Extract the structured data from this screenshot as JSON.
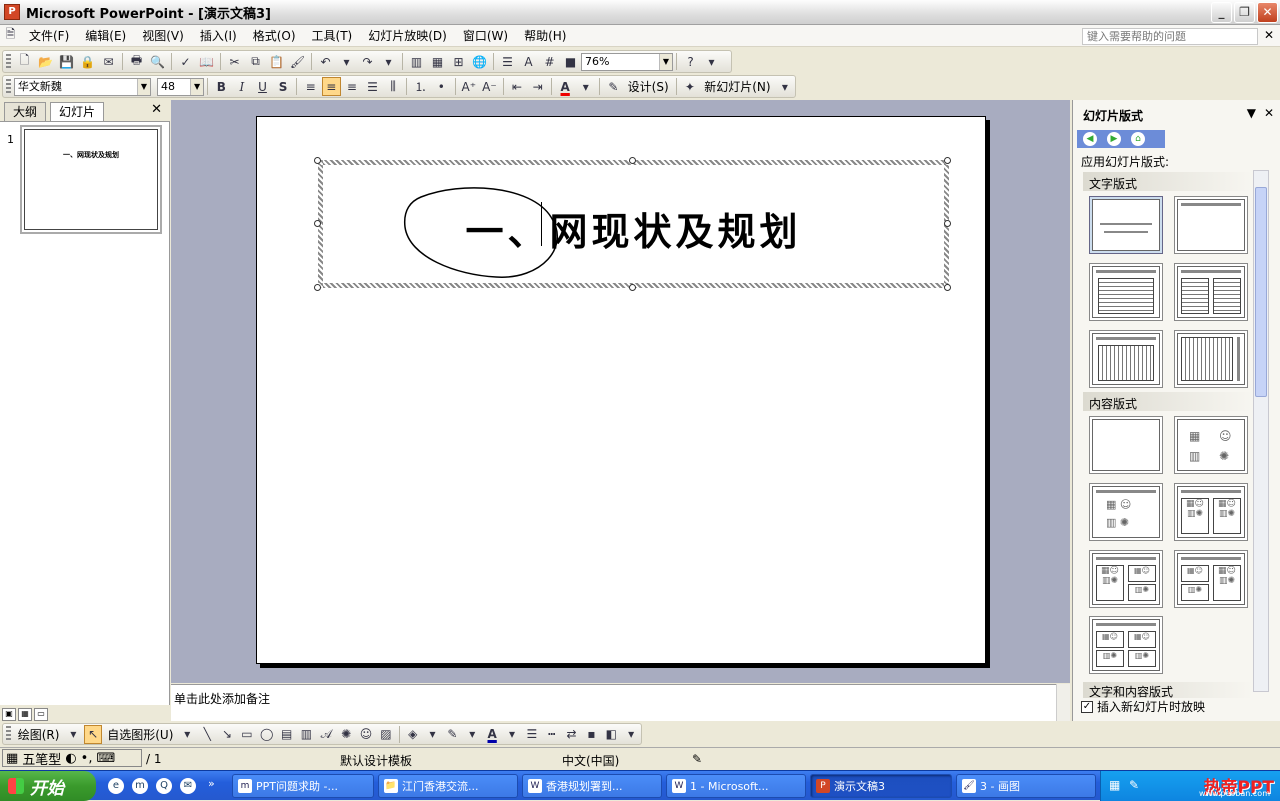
{
  "window": {
    "title": "Microsoft PowerPoint - [演示文稿3]",
    "app_icon": "powerpoint-icon"
  },
  "menu": {
    "items": [
      "文件(F)",
      "编辑(E)",
      "视图(V)",
      "插入(I)",
      "格式(O)",
      "工具(T)",
      "幻灯片放映(D)",
      "窗口(W)",
      "帮助(H)"
    ],
    "help_placeholder": "键入需要帮助的问题"
  },
  "toolbar_standard": {
    "zoom": "76%"
  },
  "toolbar_format": {
    "font": "华文新魏",
    "size": "48",
    "bold": "B",
    "italic": "I",
    "underline": "U",
    "shadow": "S",
    "design_label": "设计(S)",
    "new_slide_label": "新幻灯片(N)"
  },
  "left_panel": {
    "tabs": [
      "大纲",
      "幻灯片"
    ],
    "slide_number": "1",
    "thumb_title": "一、网现状及规划"
  },
  "slide": {
    "title": "一、网现状及规划"
  },
  "notes": {
    "placeholder": "单击此处添加备注"
  },
  "task_pane": {
    "title": "幻灯片版式",
    "apply_label": "应用幻灯片版式:",
    "sections": [
      "文字版式",
      "内容版式",
      "文字和内容版式"
    ],
    "checkbox_label": "插入新幻灯片时放映"
  },
  "drawing_toolbar": {
    "draw_label": "绘图(R)",
    "autoshape_label": "自选图形(U)"
  },
  "status_bar": {
    "slide_count": "/ 1",
    "template": "默认设计模板",
    "language": "中文(中国)",
    "ime_label": "五笔型"
  },
  "taskbar": {
    "start_label": "开始",
    "tasks": [
      "PPT问题求助 -...",
      "江门香港交流...",
      "香港规划署到...",
      "1 - Microsoft...",
      "演示文稿3",
      "3 - 画图"
    ],
    "active_task": 4,
    "brand": "热帝PPT",
    "brand_url": "www.peoban.com"
  }
}
